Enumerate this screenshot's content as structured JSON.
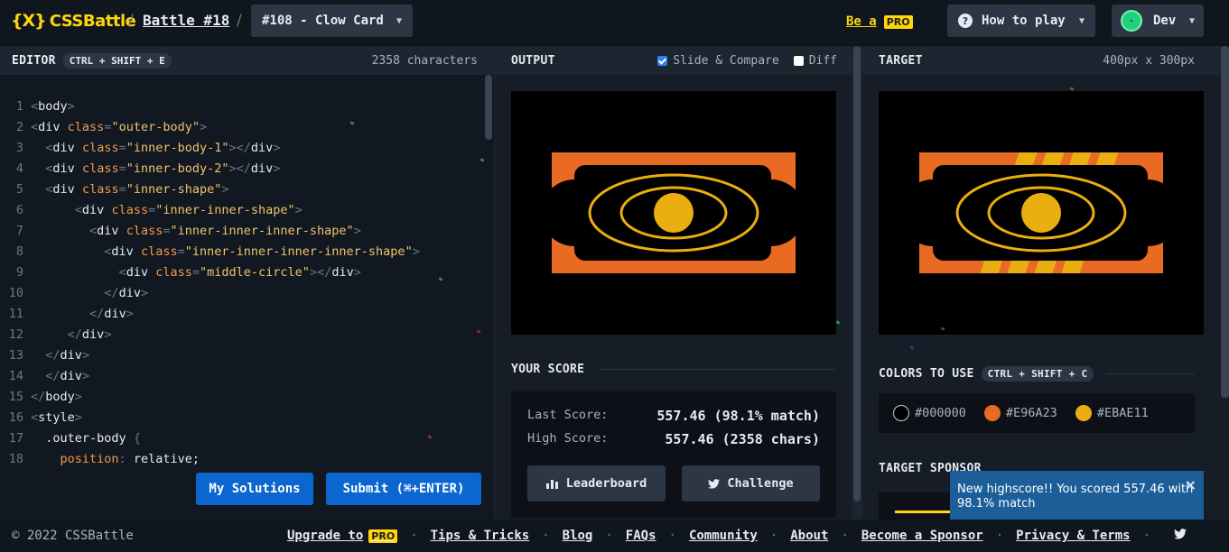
{
  "header": {
    "logo_mark": "{X}",
    "logo_text": "CSSBattle",
    "sep": "/",
    "battle": "Battle #18",
    "target_select": "#108 - Clow Card",
    "be_a": "Be a",
    "pro": "PRO",
    "how_to_play": "How to play",
    "user": "Dev"
  },
  "editor": {
    "title": "EDITOR",
    "shortcut": "CTRL + SHIFT + E",
    "char_count": "2358 characters",
    "lines": [
      {
        "n": "1",
        "indent": "",
        "tag": "body",
        "attr": "",
        "str": "",
        "close": ""
      },
      {
        "n": "2",
        "indent": "",
        "tag": "div",
        "attr": "class",
        "str": "\"outer-body\"",
        "close": ""
      },
      {
        "n": "3",
        "indent": "  ",
        "tag": "div",
        "attr": "class",
        "str": "\"inner-body-1\"",
        "close": "div"
      },
      {
        "n": "4",
        "indent": "  ",
        "tag": "div",
        "attr": "class",
        "str": "\"inner-body-2\"",
        "close": "div"
      },
      {
        "n": "5",
        "indent": "  ",
        "tag": "div",
        "attr": "class",
        "str": "\"inner-shape\"",
        "close": ""
      },
      {
        "n": "6",
        "indent": "      ",
        "tag": "div",
        "attr": "class",
        "str": "\"inner-inner-shape\"",
        "close": ""
      },
      {
        "n": "7",
        "indent": "        ",
        "tag": "div",
        "attr": "class",
        "str": "\"inner-inner-inner-shape\"",
        "close": ""
      },
      {
        "n": "8",
        "indent": "          ",
        "tag": "div",
        "attr": "class",
        "str": "\"inner-inner-inner-inner-shape\"",
        "close": ""
      },
      {
        "n": "9",
        "indent": "            ",
        "tag": "div",
        "attr": "class",
        "str": "\"middle-circle\"",
        "close": "div"
      },
      {
        "n": "10",
        "indent": "          ",
        "tag": "/div",
        "attr": "",
        "str": "",
        "close": ""
      },
      {
        "n": "11",
        "indent": "        ",
        "tag": "/div",
        "attr": "",
        "str": "",
        "close": ""
      },
      {
        "n": "12",
        "indent": "     ",
        "tag": "/div",
        "attr": "",
        "str": "",
        "close": ""
      },
      {
        "n": "13",
        "indent": "  ",
        "tag": "/div",
        "attr": "",
        "str": "",
        "close": ""
      },
      {
        "n": "14",
        "indent": "  ",
        "tag": "/div",
        "attr": "",
        "str": "",
        "close": ""
      },
      {
        "n": "15",
        "indent": "",
        "tag": "/body",
        "attr": "",
        "str": "",
        "close": ""
      },
      {
        "n": "16",
        "indent": "",
        "tag": "style",
        "attr": "",
        "str": "",
        "close": ""
      }
    ],
    "line17_selector": ".outer-body",
    "line17_brace": "{",
    "line18_prop": "position",
    "line18_value": "relative;",
    "my_solutions": "My Solutions",
    "submit": "Submit (⌘+ENTER)"
  },
  "output": {
    "title": "OUTPUT",
    "slide_compare": "Slide & Compare",
    "diff": "Diff",
    "your_score": "YOUR SCORE",
    "last_score_label": "Last Score:",
    "last_score_value": "557.46 (98.1% match)",
    "high_score_label": "High Score:",
    "high_score_value": "557.46 (2358 chars)",
    "leaderboard": "Leaderboard",
    "challenge": "Challenge"
  },
  "target": {
    "title": "TARGET",
    "size": "400px x 300px",
    "colors_title": "COLORS TO USE",
    "colors_shortcut": "CTRL + SHIFT + C",
    "colors": [
      "#000000",
      "#E96A23",
      "#EBAE11"
    ],
    "sponsor_title": "TARGET SPONSOR"
  },
  "toast": {
    "message": "New highscore!! You scored 557.46 with 98.1% match",
    "close": "×"
  },
  "footer": {
    "copyright": "© 2022 CSSBattle",
    "upgrade": "Upgrade to",
    "pro": "PRO",
    "links": [
      "Tips & Tricks",
      "Blog",
      "FAQs",
      "Community",
      "About",
      "Become a Sponsor",
      "Privacy & Terms"
    ]
  }
}
